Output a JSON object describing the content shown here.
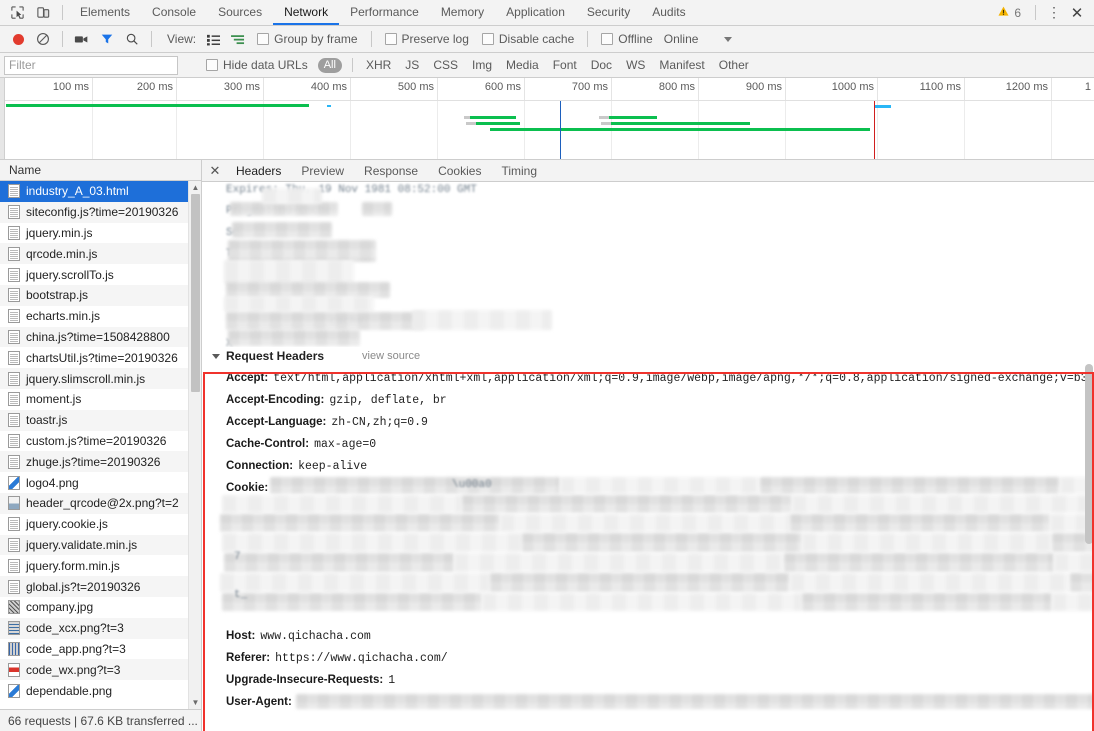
{
  "window": {
    "panel_tabs": [
      "Elements",
      "Console",
      "Sources",
      "Network",
      "Performance",
      "Memory",
      "Application",
      "Security",
      "Audits"
    ],
    "active_panel": "Network",
    "warning_count": "6",
    "kebab_glyph": "⋮",
    "close_glyph": "✕"
  },
  "network_toolbar": {
    "view_label": "View:",
    "group_by_frame": "Group by frame",
    "preserve_log": "Preserve log",
    "disable_cache": "Disable cache",
    "offline": "Offline",
    "online": "Online"
  },
  "filter_bar": {
    "placeholder": "Filter",
    "value": "",
    "hide_data_urls": "Hide data URLs",
    "all_pill": "All",
    "types": [
      "XHR",
      "JS",
      "CSS",
      "Img",
      "Media",
      "Font",
      "Doc",
      "WS",
      "Manifest",
      "Other"
    ]
  },
  "timeline": {
    "ticks": [
      "100 ms",
      "200 ms",
      "300 ms",
      "400 ms",
      "500 ms",
      "600 ms",
      "700 ms",
      "800 ms",
      "900 ms",
      "1000 ms",
      "1100 ms",
      "1200 ms",
      "1"
    ],
    "dom_content_loaded_color": "#1c5fbd",
    "load_event_color": "#d01e1e"
  },
  "request_list": {
    "column_header": "Name",
    "selected_index": 0,
    "items": [
      {
        "name": "industry_A_03.html",
        "icon": "document-icon"
      },
      {
        "name": "siteconfig.js?time=20190326",
        "icon": "document-icon"
      },
      {
        "name": "jquery.min.js",
        "icon": "document-icon"
      },
      {
        "name": "qrcode.min.js",
        "icon": "document-icon"
      },
      {
        "name": "jquery.scrollTo.js",
        "icon": "document-icon"
      },
      {
        "name": "bootstrap.js",
        "icon": "document-icon"
      },
      {
        "name": "echarts.min.js",
        "icon": "document-icon"
      },
      {
        "name": "china.js?time=1508428800",
        "icon": "document-icon"
      },
      {
        "name": "chartsUtil.js?time=20190326",
        "icon": "document-icon"
      },
      {
        "name": "jquery.slimscroll.min.js",
        "icon": "document-icon"
      },
      {
        "name": "moment.js",
        "icon": "document-icon"
      },
      {
        "name": "toastr.js",
        "icon": "document-icon"
      },
      {
        "name": "custom.js?time=20190326",
        "icon": "document-icon"
      },
      {
        "name": "zhuge.js?time=20190326",
        "icon": "document-icon"
      },
      {
        "name": "logo4.png",
        "icon": "image-icon"
      },
      {
        "name": "header_qrcode@2x.png?t=2",
        "icon": "image-icon"
      },
      {
        "name": "jquery.cookie.js",
        "icon": "document-icon"
      },
      {
        "name": "jquery.validate.min.js",
        "icon": "document-icon"
      },
      {
        "name": "jquery.form.min.js",
        "icon": "document-icon"
      },
      {
        "name": "global.js?t=20190326",
        "icon": "document-icon"
      },
      {
        "name": "company.jpg",
        "icon": "image-icon"
      },
      {
        "name": "code_xcx.png?t=3",
        "icon": "image-icon"
      },
      {
        "name": "code_app.png?t=3",
        "icon": "image-icon"
      },
      {
        "name": "code_wx.png?t=3",
        "icon": "image-icon"
      },
      {
        "name": "dependable.png",
        "icon": "image-icon"
      }
    ],
    "status": "66 requests  |  67.6 KB transferred  ..."
  },
  "detail_pane": {
    "tabs": [
      "Headers",
      "Preview",
      "Response",
      "Cookies",
      "Timing"
    ],
    "active_tab": "Headers",
    "close_glyph": "✕",
    "request_headers": {
      "title": "Request Headers",
      "view_source": "view source",
      "rows": [
        {
          "name": "Accept:",
          "value": "text/html,application/xhtml+xml,application/xml;q=0.9,image/webp,image/apng,*/*;q=0.8,application/signed-exchange;v=b3",
          "redacted": false
        },
        {
          "name": "Accept-Encoding:",
          "value": "gzip, deflate, br",
          "redacted": false
        },
        {
          "name": "Accept-Language:",
          "value": "zh-CN,zh;q=0.9",
          "redacted": false
        },
        {
          "name": "Cache-Control:",
          "value": "max-age=0",
          "redacted": false
        },
        {
          "name": "Connection:",
          "value": "keep-alive",
          "redacted": false
        },
        {
          "name": "Cookie:",
          "value": "",
          "redacted": true
        },
        {
          "name": "Host:",
          "value": "www.qichacha.com",
          "redacted": false
        },
        {
          "name": "Referer:",
          "value": "https://www.qichacha.com/",
          "redacted": false
        },
        {
          "name": "Upgrade-Insecure-Requests:",
          "value": "1",
          "redacted": false
        },
        {
          "name": "User-Agent:",
          "value": "",
          "redacted": true
        }
      ]
    },
    "response_headers_ghosts": [
      "Expires: Thu, 19 Nov 1981 08:52:00 GMT",
      "Pragma: no-cache",
      "Se",
      "T",
      "cache",
      "X"
    ]
  },
  "colors": {
    "accent_tab": "#1a73e8",
    "selection": "#1e6fd9",
    "highlight_box": "#f0322c",
    "waterfall_green": "#0bbf4f",
    "waterfall_blue": "#29b6f6",
    "warning": "#f5b400"
  }
}
